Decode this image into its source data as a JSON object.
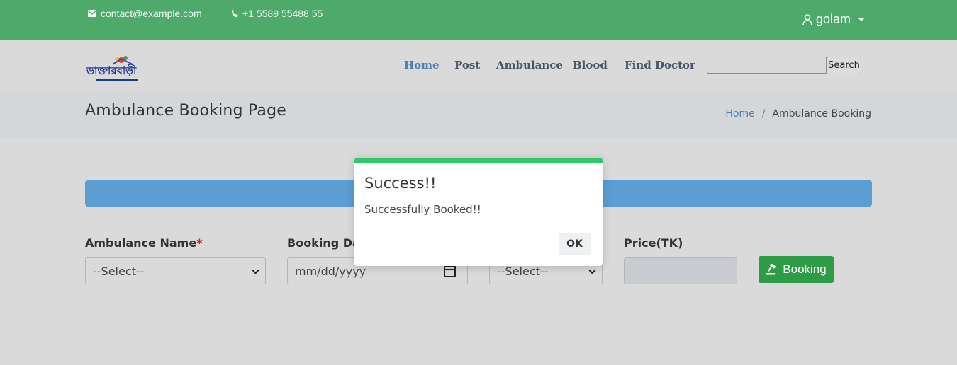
{
  "topbar": {
    "email": "contact@example.com",
    "phone": "+1 5589 55488 55",
    "user": "golam",
    "icons": {
      "email": "envelope-icon",
      "phone": "phone-icon",
      "user": "user-doctor-icon"
    },
    "bg_color": "#4daa6b"
  },
  "navbar": {
    "logo_name": "ডাক্তারবাড়ী",
    "items": [
      {
        "label": "Home",
        "active": true
      },
      {
        "label": "Post"
      },
      {
        "label": "Ambulance"
      },
      {
        "label": "Blood"
      },
      {
        "label": "Find Doctor"
      }
    ],
    "search": {
      "button_label": "Search",
      "value": ""
    }
  },
  "page": {
    "title": "Ambulance Booking Page",
    "breadcrumb": [
      "Home",
      "/",
      "Ambulance Booking"
    ]
  },
  "form": {
    "fields": [
      {
        "label": "Ambulance Name",
        "required_mark": "*",
        "value": "--Select--"
      },
      {
        "label": "Booking Date",
        "placeholder": "mm/dd/yyyy"
      },
      {
        "label": "",
        "value": "--Select--"
      },
      {
        "label": "Price(TK)",
        "value": ""
      }
    ],
    "submit_label": "Booking",
    "submit_icon": "gavel-icon",
    "accent_bar_color": "#5a9ed4"
  },
  "dialog": {
    "title": "Success!!",
    "message": "Successfully Booked!!",
    "ok_label": "OK",
    "accent_color": "#2fc86a"
  }
}
